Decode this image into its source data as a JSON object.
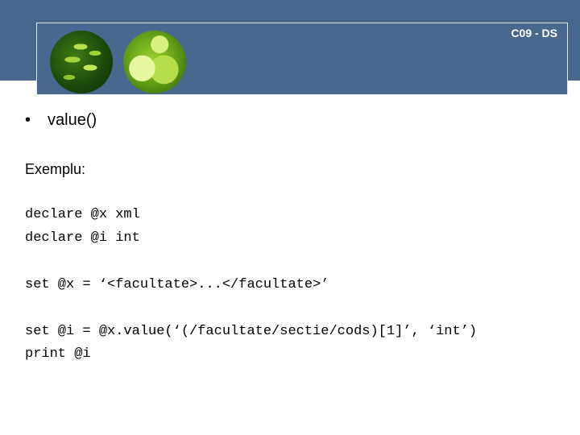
{
  "header": {
    "slide_id": "C09 - DS"
  },
  "images": {
    "left": "fern-leaf-image",
    "right": "green-puzzle-image"
  },
  "content": {
    "bullet_symbol": "•",
    "bullet_text": "value()",
    "example_label": "Exemplu:",
    "code_lines": [
      "declare @x xml",
      "declare @i int",
      "set @x = ‘<facultate>...</facultate>’",
      "set @i = @x.value(‘(/facultate/sectie/cods)[1]’, ‘int’)",
      "print @i"
    ]
  },
  "colors": {
    "header_bg": "#4a6790",
    "header_text": "#ffffff",
    "body_text": "#000000"
  }
}
